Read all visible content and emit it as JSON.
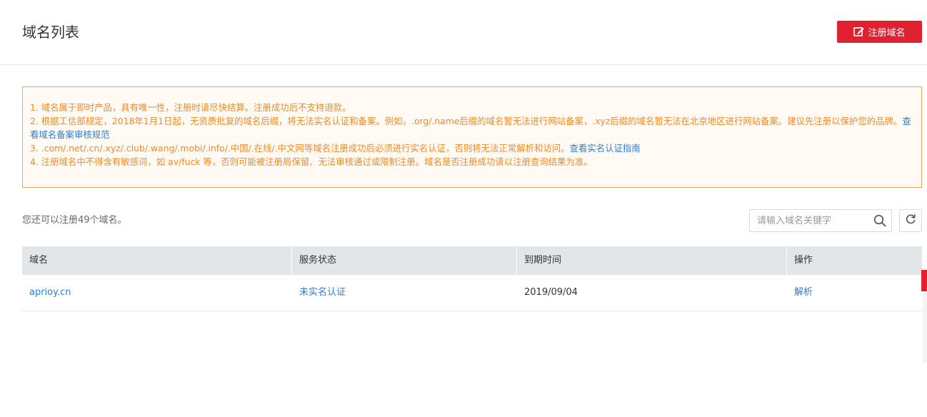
{
  "header": {
    "title": "域名列表",
    "register_label": "注册域名"
  },
  "notice": {
    "line1": "1. 域名属于即时产品，具有唯一性，注册时请尽快结算。注册成功后不支持退款。",
    "line2": "2. 根据工信部规定，2018年1月1日起，无资质批复的域名后缀，将无法实名认证和备案。例如，.org/.name后缀的域名暂无法进行网站备案，.xyz后缀的域名暂无法在北京地区进行网站备案。建议先注册以保护您的品牌。",
    "line2_link": "查看域名备案审核规范",
    "line3": "3. .com/.net/.cn/.xyz/.club/.wang/.mobi/.info/.中国/.在线/.中文网等域名注册成功后必须进行实名认证，否则将无法正常解析和访问。",
    "line3_link": "查看实名认证指南",
    "line4": "4. 注册域名中不得含有敏感词，如 av/fuck 等，否则可能被注册局保留、无法审核通过或限制注册。域名是否注册成功请以注册查询结果为准。"
  },
  "quota": {
    "text": "您还可以注册49个域名。"
  },
  "search": {
    "placeholder": "请输入域名关键字",
    "value": ""
  },
  "table": {
    "headers": [
      "域名",
      "服务状态",
      "到期时间",
      "操作"
    ],
    "rows": [
      {
        "domain": "aprioy.cn",
        "status": "未实名认证",
        "expiry": "2019/09/04",
        "action": "解析"
      }
    ]
  },
  "colors": {
    "brand_red": "#e02130",
    "link_blue": "#2e7dd1",
    "notice_orange": "#f08a24",
    "table_header_bg": "#e3e6e8"
  },
  "icons": {
    "register": "edit-icon",
    "search": "search-icon",
    "refresh": "refresh-icon"
  }
}
